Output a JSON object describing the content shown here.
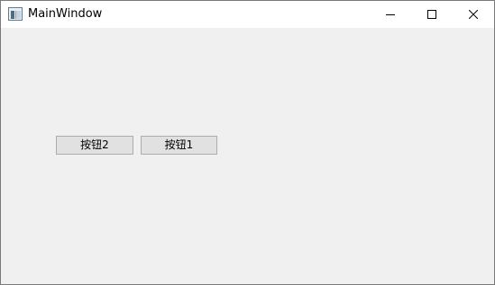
{
  "window": {
    "title": "MainWindow",
    "icons": {
      "app": "app-window-icon",
      "minimize": "minimize-icon",
      "maximize": "maximize-icon",
      "close": "close-icon"
    }
  },
  "content": {
    "buttons": [
      {
        "label": "按钮2"
      },
      {
        "label": "按钮1"
      }
    ]
  },
  "colors": {
    "client_background": "#f0f0f0",
    "titlebar_background": "#ffffff",
    "button_face": "#e1e1e1",
    "button_border": "#adadad"
  }
}
